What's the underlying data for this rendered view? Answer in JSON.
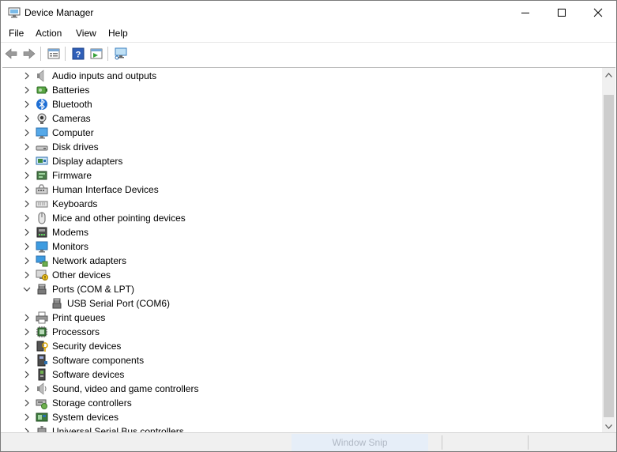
{
  "window": {
    "title": "Device Manager"
  },
  "menu": {
    "items": [
      "File",
      "Action",
      "View",
      "Help"
    ]
  },
  "toolbar": {
    "buttons": [
      "back-icon",
      "forward-icon",
      "properties-icon",
      "help-icon",
      "update-driver-icon",
      "scan-hardware-icon"
    ]
  },
  "tree": {
    "items": [
      {
        "label": "Audio inputs and outputs",
        "icon": "speaker-icon",
        "state": "collapsed"
      },
      {
        "label": "Batteries",
        "icon": "battery-icon",
        "state": "collapsed"
      },
      {
        "label": "Bluetooth",
        "icon": "bluetooth-icon",
        "state": "collapsed"
      },
      {
        "label": "Cameras",
        "icon": "camera-icon",
        "state": "collapsed"
      },
      {
        "label": "Computer",
        "icon": "computer-icon",
        "state": "collapsed"
      },
      {
        "label": "Disk drives",
        "icon": "disk-icon",
        "state": "collapsed"
      },
      {
        "label": "Display adapters",
        "icon": "display-adapter-icon",
        "state": "collapsed"
      },
      {
        "label": "Firmware",
        "icon": "firmware-icon",
        "state": "collapsed"
      },
      {
        "label": "Human Interface Devices",
        "icon": "hid-icon",
        "state": "collapsed"
      },
      {
        "label": "Keyboards",
        "icon": "keyboard-icon",
        "state": "collapsed"
      },
      {
        "label": "Mice and other pointing devices",
        "icon": "mouse-icon",
        "state": "collapsed"
      },
      {
        "label": "Modems",
        "icon": "modem-icon",
        "state": "collapsed"
      },
      {
        "label": "Monitors",
        "icon": "monitor-icon",
        "state": "collapsed"
      },
      {
        "label": "Network adapters",
        "icon": "network-icon",
        "state": "collapsed"
      },
      {
        "label": "Other devices",
        "icon": "other-device-icon",
        "state": "collapsed"
      },
      {
        "label": "Ports (COM & LPT)",
        "icon": "port-icon",
        "state": "expanded"
      },
      {
        "label": "USB Serial Port (COM6)",
        "icon": "port-icon",
        "state": "child"
      },
      {
        "label": "Print queues",
        "icon": "printer-icon",
        "state": "collapsed"
      },
      {
        "label": "Processors",
        "icon": "processor-icon",
        "state": "collapsed"
      },
      {
        "label": "Security devices",
        "icon": "security-icon",
        "state": "collapsed"
      },
      {
        "label": "Software components",
        "icon": "software-component-icon",
        "state": "collapsed"
      },
      {
        "label": "Software devices",
        "icon": "software-device-icon",
        "state": "collapsed"
      },
      {
        "label": "Sound, video and game controllers",
        "icon": "sound-icon",
        "state": "collapsed"
      },
      {
        "label": "Storage controllers",
        "icon": "storage-icon",
        "state": "collapsed"
      },
      {
        "label": "System devices",
        "icon": "system-icon",
        "state": "collapsed"
      },
      {
        "label": "Universal Serial Bus controllers",
        "icon": "usb-icon",
        "state": "collapsed"
      }
    ]
  },
  "status": {
    "snip_text": "Window Snip"
  }
}
